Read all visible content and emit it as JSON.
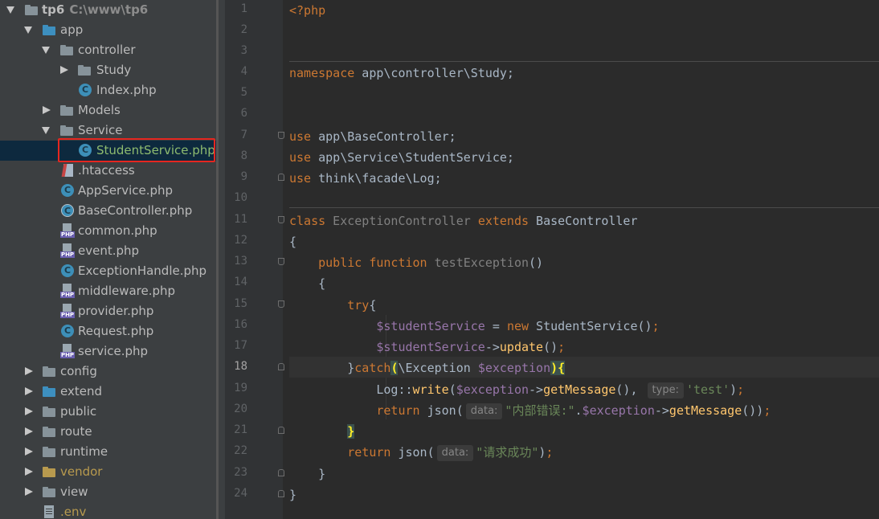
{
  "project": {
    "root": {
      "label": "tp6",
      "path": "C:\\www\\tp6"
    },
    "items": [
      {
        "label": "app"
      },
      {
        "label": "controller"
      },
      {
        "label": "Study"
      },
      {
        "label": "Index.php"
      },
      {
        "label": "Models"
      },
      {
        "label": "Service"
      },
      {
        "label": "StudentService.php"
      },
      {
        "label": ".htaccess"
      },
      {
        "label": "AppService.php"
      },
      {
        "label": "BaseController.php"
      },
      {
        "label": "common.php"
      },
      {
        "label": "event.php"
      },
      {
        "label": "ExceptionHandle.php"
      },
      {
        "label": "middleware.php"
      },
      {
        "label": "provider.php"
      },
      {
        "label": "Request.php"
      },
      {
        "label": "service.php"
      },
      {
        "label": "config"
      },
      {
        "label": "extend"
      },
      {
        "label": "public"
      },
      {
        "label": "route"
      },
      {
        "label": "runtime"
      },
      {
        "label": "vendor"
      },
      {
        "label": "view"
      },
      {
        "label": ".env"
      }
    ]
  },
  "editor": {
    "line_numbers": [
      "1",
      "2",
      "3",
      "4",
      "5",
      "6",
      "7",
      "8",
      "9",
      "10",
      "11",
      "12",
      "13",
      "14",
      "15",
      "16",
      "17",
      "18",
      "19",
      "20",
      "21",
      "22",
      "23",
      "24"
    ],
    "current_line": "18",
    "code": {
      "l1": "<?php",
      "l4_kw": "namespace",
      "l4_rest": " app\\controller\\Study;",
      "l7_kw": "use",
      "l7_rest": " app\\BaseController;",
      "l8_kw": "use",
      "l8_rest": " app\\Service\\StudentService;",
      "l9_kw": "use",
      "l9_rest": " think\\facade\\Log;",
      "l11_kw": "class",
      "l11_name": " ExceptionController ",
      "l11_kw2": "extends",
      "l11_rest": " BaseController",
      "l12": "{",
      "l13_kw": "public function",
      "l13_fn": " testException",
      "l13_rest": "()",
      "l14": "{",
      "l15_kw": "try",
      "l15_rest": "{",
      "l16_var": "$studentService",
      "l16_op": " = ",
      "l16_kw": "new",
      "l16_rest": " StudentService()",
      "l16_semi": ";",
      "l17_var": "$studentService",
      "l17_arrow": "->",
      "l17_fn": "update",
      "l17_rest": "()",
      "l17_semi": ";",
      "l18_brace": "}",
      "l18_kw": "catch",
      "l18_open": "(",
      "l18_cls": "\\Exception ",
      "l18_var": "$exception",
      "l18_close": ")",
      "l18_brace2": "{",
      "l19_cls": "Log::",
      "l19_fn": "write",
      "l19_open": "(",
      "l19_var": "$exception",
      "l19_arrow": "->",
      "l19_fn2": "getMessage",
      "l19_mid": "(), ",
      "l19_hint": "type:",
      "l19_str": "'test'",
      "l19_close": ")",
      "l19_semi": ";",
      "l20_kw": "return",
      "l20_fn": " json(",
      "l20_hint": "data:",
      "l20_str": "\"内部错误:\"",
      "l20_dot": ".",
      "l20_var": "$exception",
      "l20_arrow": "->",
      "l20_fn2": "getMessage",
      "l20_close": "())",
      "l20_semi": ";",
      "l21": "}",
      "l22_kw": "return",
      "l22_fn": " json(",
      "l22_hint": "data:",
      "l22_str": "\"请求成功\"",
      "l22_close": ")",
      "l22_semi": ";",
      "l23": "}",
      "l24": "}"
    }
  },
  "colors": {
    "keyword": "#cc7832",
    "variable": "#9876aa",
    "function": "#ffc66d",
    "string": "#6a8759",
    "highlight_box": "#e5261f"
  }
}
